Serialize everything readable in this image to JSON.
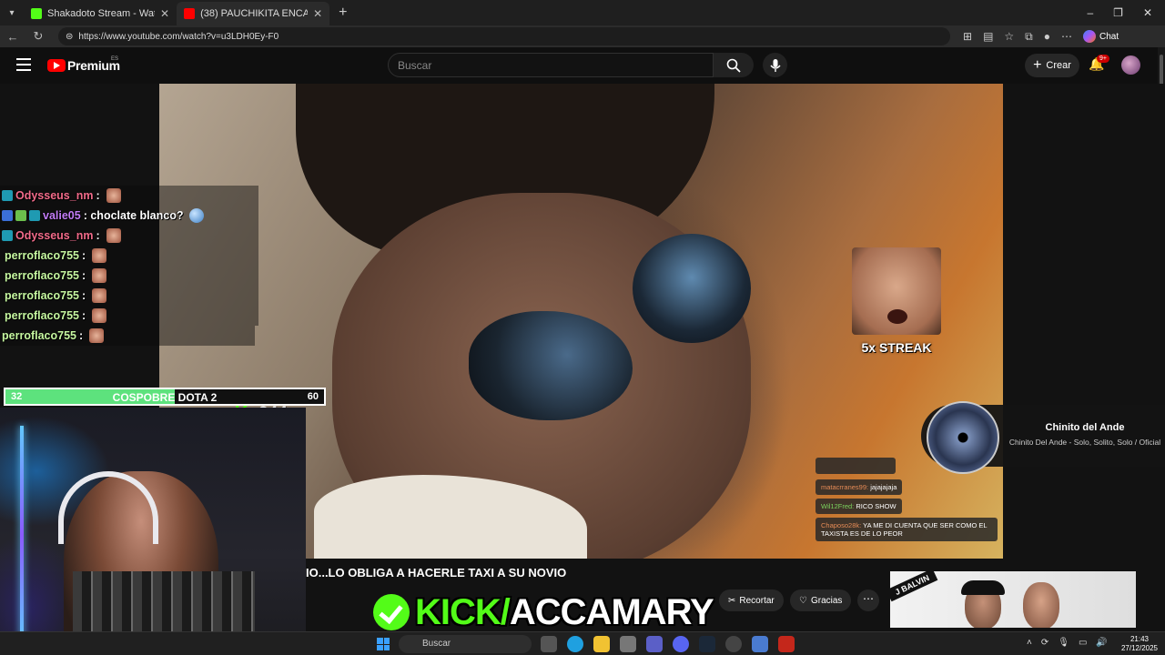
{
  "browser": {
    "tabs": [
      {
        "title": "Shakadoto Stream - Watch Live on",
        "favicon_color": "#53fc18"
      },
      {
        "title": "(38) PAUCHIKITA ENCARA TAXISTA",
        "favicon_color": "#ff0000"
      }
    ],
    "url": "https://www.youtube.com/watch?v=u3LDH0Ey-F0",
    "chat_button": "Chat"
  },
  "youtube": {
    "brand": "Premium",
    "region": "ES",
    "search_placeholder": "Buscar",
    "create_label": "Crear",
    "notifications": "9+"
  },
  "stream_chat": [
    {
      "user": "Odysseus_nm",
      "text": ":",
      "color": "#f26b8a",
      "badges": 1,
      "emote": "face"
    },
    {
      "user": "valie05",
      "text": ": choclate blanco?",
      "color": "#c27cf6",
      "badges": 3,
      "emote": "globe"
    },
    {
      "user": "Odysseus_nm",
      "text": ":",
      "color": "#f26b8a",
      "badges": 1,
      "emote": "face"
    },
    {
      "user": "perroflaco755",
      "text": ":",
      "color": "#c6f7a0",
      "badges": 0,
      "emote": "face"
    },
    {
      "user": "perroflaco755",
      "text": ":",
      "color": "#c6f7a0",
      "badges": 0,
      "emote": "face"
    },
    {
      "user": "perroflaco755",
      "text": ":",
      "color": "#c6f7a0",
      "badges": 0,
      "emote": "face"
    },
    {
      "user": "perroflaco755",
      "text": ":",
      "color": "#c6f7a0",
      "badges": 0,
      "emote": "face"
    },
    {
      "user": "perroflaco755",
      "text": ":",
      "color": "#c6f7a0",
      "badges": 0,
      "emote": "face"
    }
  ],
  "poll": {
    "left_value": "32",
    "title": "COSPOBRE DOTA 2",
    "right_value": "60",
    "fill_fraction": 0.53
  },
  "viewer_count": "244",
  "streak": {
    "label": "5x STREAK"
  },
  "now_playing": {
    "title": "Chinito del Ande",
    "subtitle": "Chinito Del Ande - Solo, Solito, Solo / Oficial"
  },
  "inner_chat": [
    {
      "user": "",
      "text": ""
    },
    {
      "user": "matacrranes99:",
      "text": "jajajajaja"
    },
    {
      "user": "Wil12Fred:",
      "text": "RICO SHOW"
    },
    {
      "user": "Chaposo28k:",
      "text": "YA ME DI CUENTA QUE SER COMO EL TAXISTA ES DE LO PEOR"
    }
  ],
  "video": {
    "title": "IO...LO OBLIGA A HACERLE TAXI A SU NOVIO",
    "actions": {
      "clip": "Recortar",
      "thanks": "Gracias"
    }
  },
  "thumbnail": {
    "tag": "J BALVIN"
  },
  "kick_banner": {
    "prefix": "KICK/",
    "user": "ACCAMARY"
  },
  "taskbar": {
    "search": "Buscar",
    "time": "21:43",
    "date": "27/12/2025"
  }
}
